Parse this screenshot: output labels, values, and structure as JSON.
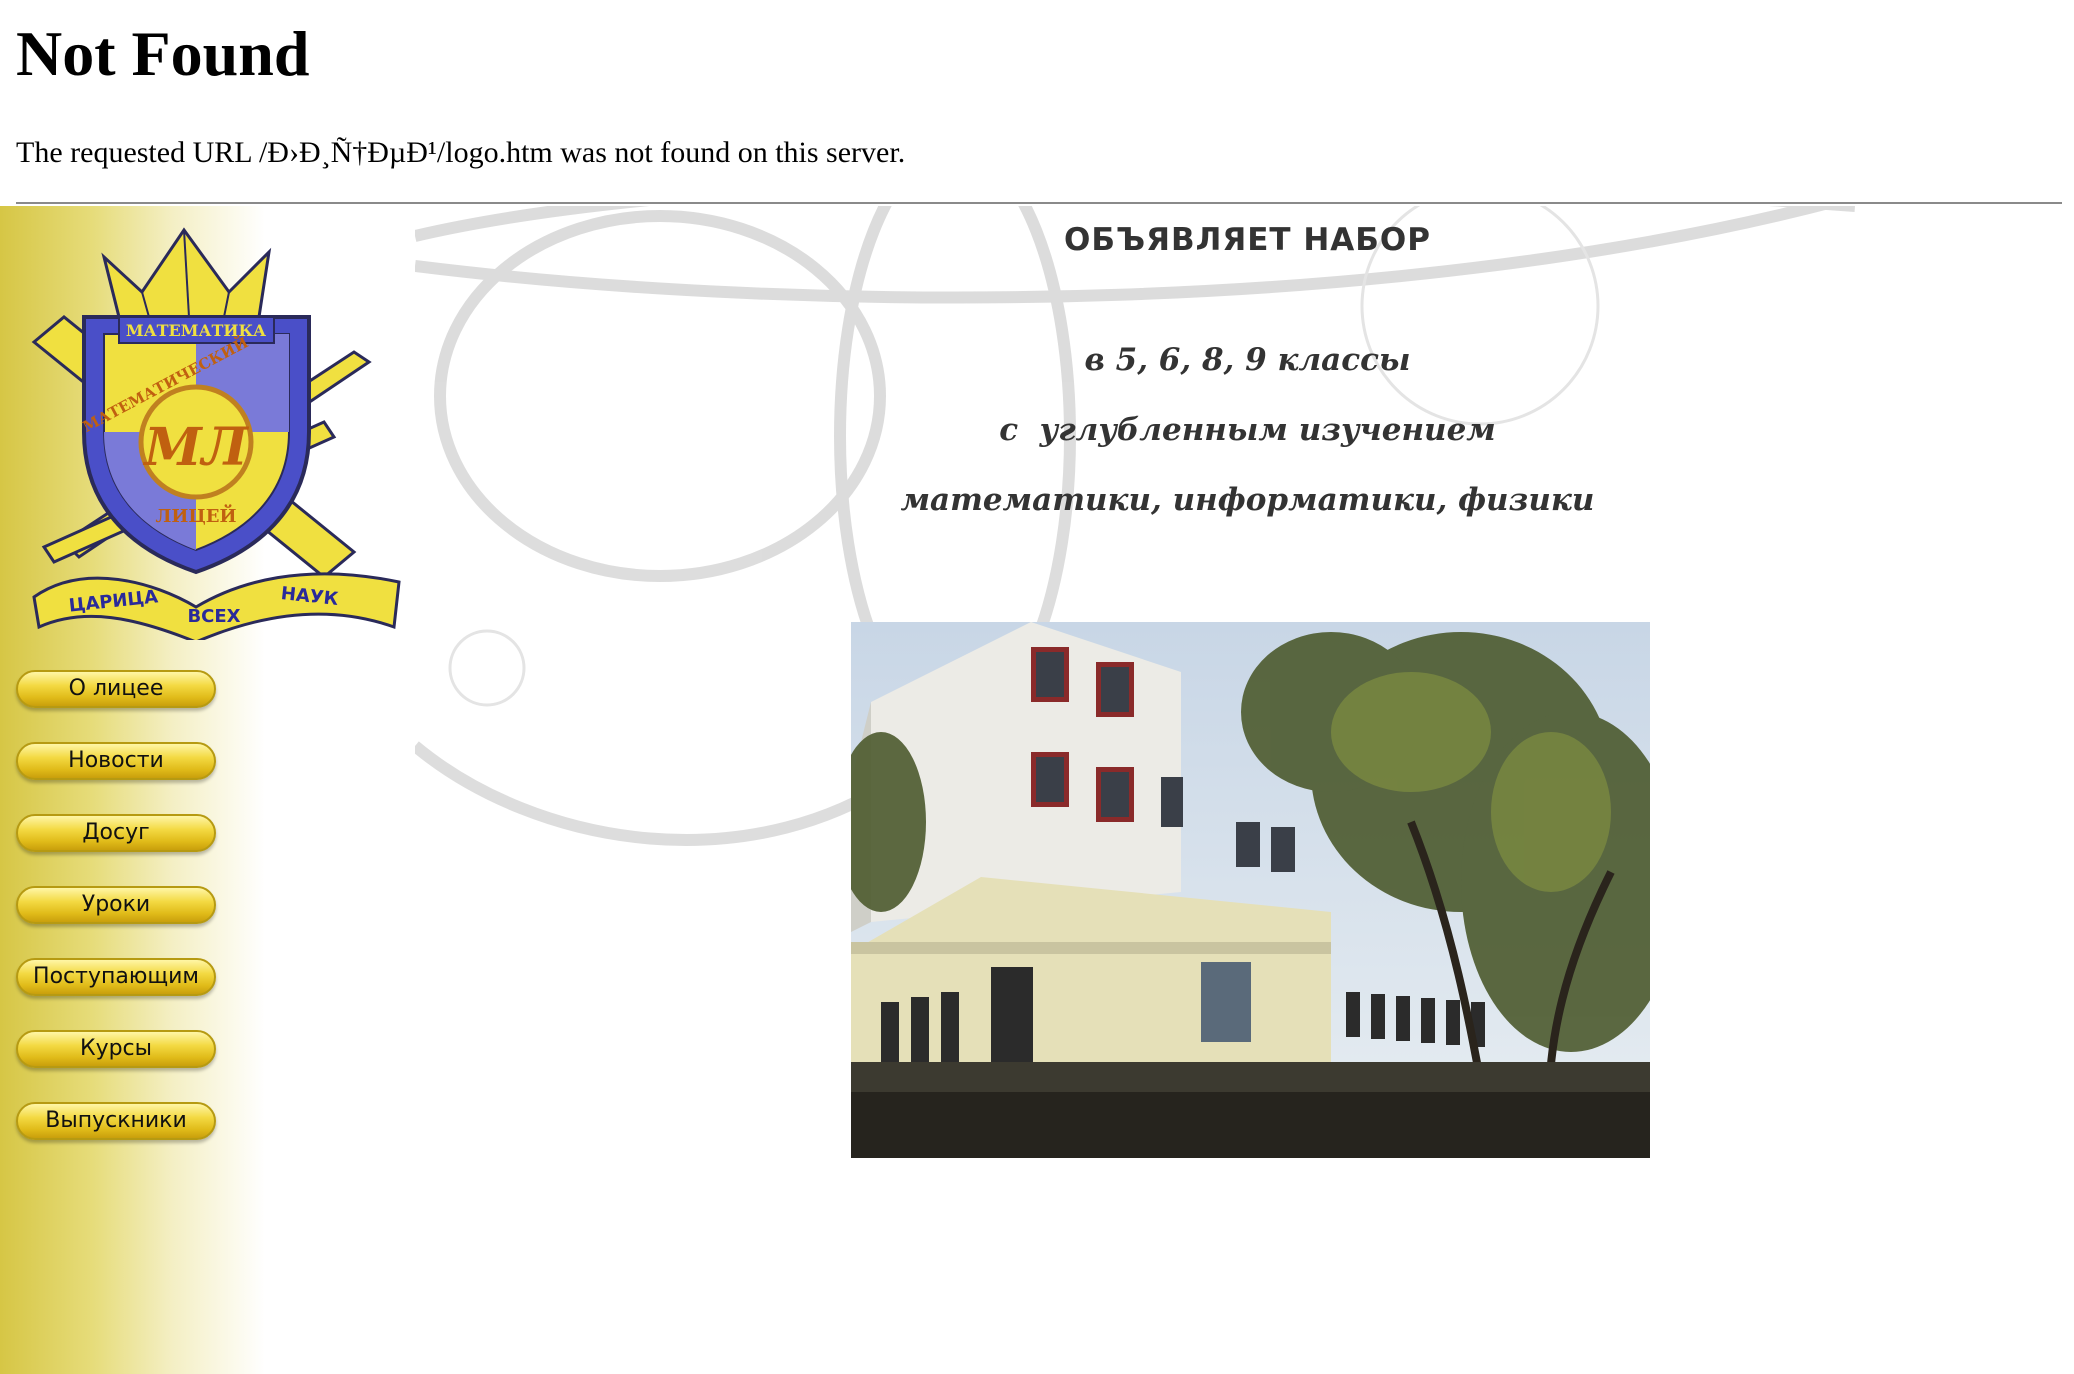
{
  "error": {
    "title": "Not Found",
    "message": "The requested URL /Ð›Ð¸Ñ†ÐµÐ¹/logo.htm was not found on this server."
  },
  "logo": {
    "top_ribbon": "МАТЕМАТИКА",
    "arc_text": "МАТЕМАТИЧЕСКИЙ",
    "bottom_arc_text": "ЛИЦЕЙ",
    "monogram": "МЛ",
    "banner_left": "ЦАРИЦА",
    "banner_middle": "ВСЕХ",
    "banner_right": "НАУК",
    "colors": {
      "shield_blue": "#4a4fc8",
      "gold": "#f0e040",
      "dark_outline": "#2a2a5a"
    }
  },
  "nav": {
    "items": [
      {
        "label": "О лицее"
      },
      {
        "label": "Новости"
      },
      {
        "label": "Досуг"
      },
      {
        "label": "Уроки"
      },
      {
        "label": "Поступающим"
      },
      {
        "label": "Курсы"
      },
      {
        "label": "Выпускники"
      }
    ]
  },
  "announcement": {
    "title": "ОБЪЯВЛЯЕТ НАБОР",
    "line1": "в 5, 6, 8, 9 классы",
    "line2": "с  углубленным изучением",
    "line3": "математики, информатики, физики"
  },
  "photo": {
    "icon": "school-building-photo"
  }
}
